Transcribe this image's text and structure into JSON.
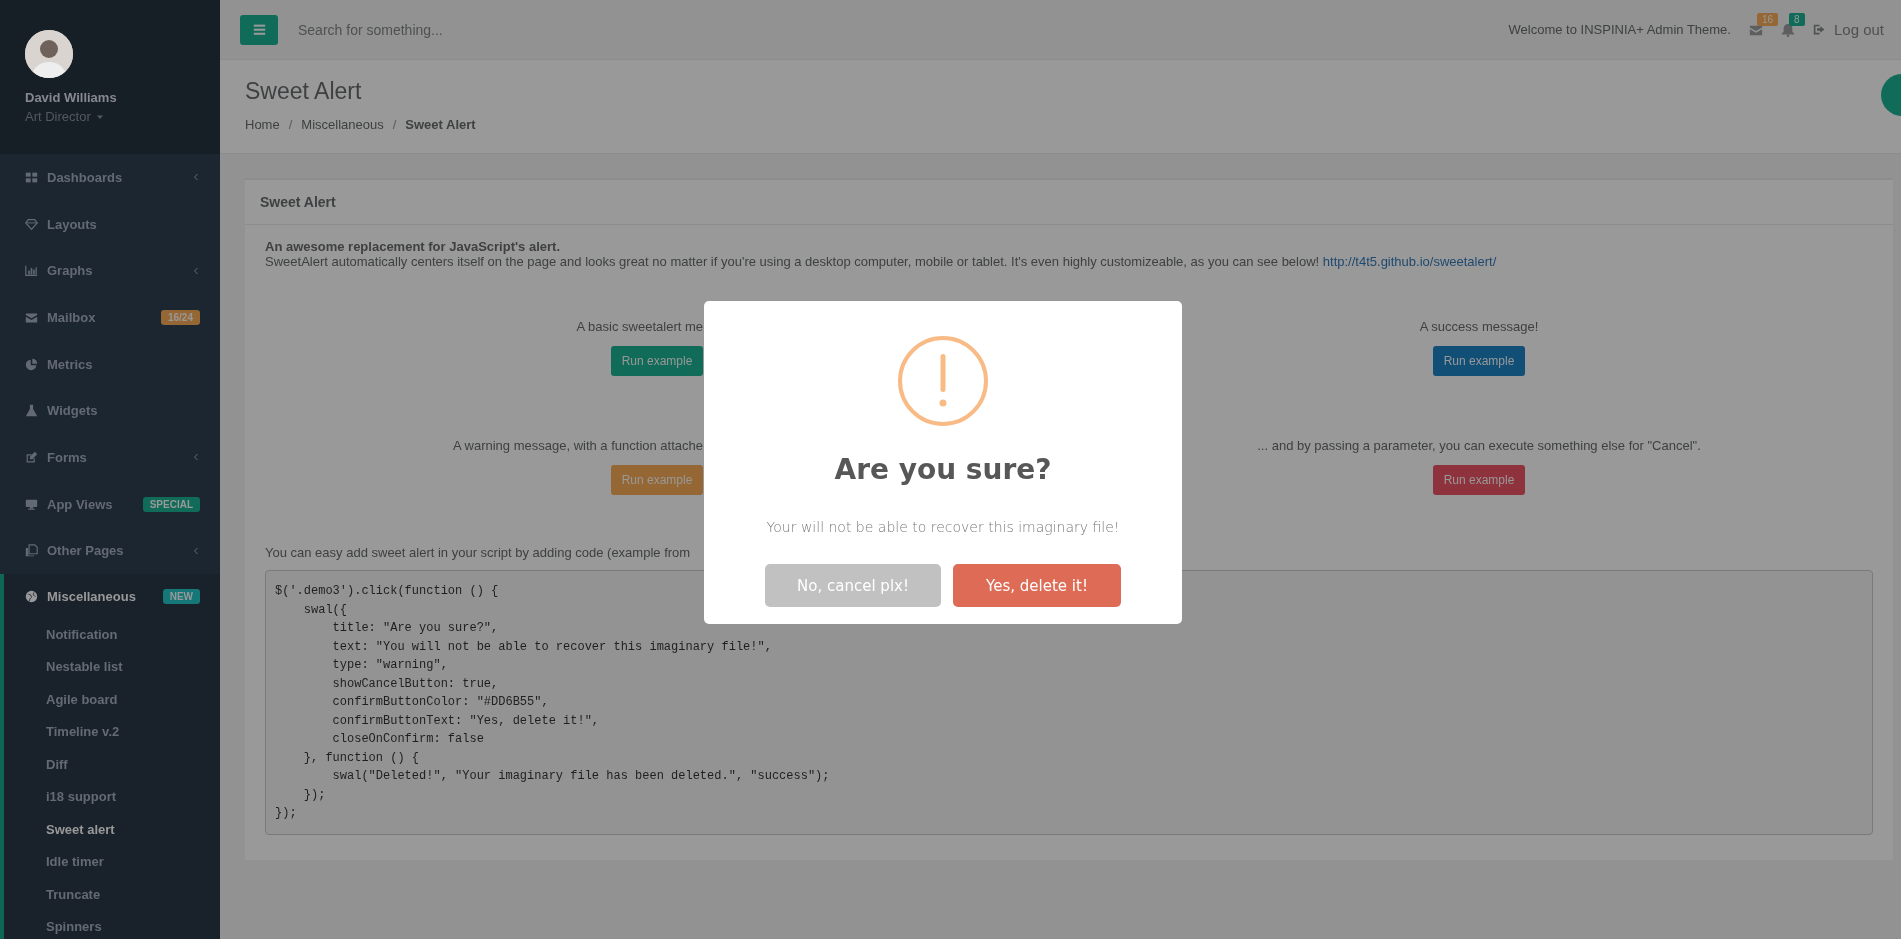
{
  "sidebar": {
    "profile": {
      "name": "David Williams",
      "role": "Art Director"
    },
    "items": [
      {
        "label": "Dashboards",
        "expandable": true,
        "selected": false
      },
      {
        "label": "Layouts",
        "expandable": false,
        "selected": false
      },
      {
        "label": "Graphs",
        "expandable": true,
        "selected": false
      },
      {
        "label": "Mailbox",
        "expandable": false,
        "selected": false,
        "badge": {
          "text": "16/24",
          "color": "#956735"
        }
      },
      {
        "label": "Metrics",
        "expandable": false,
        "selected": false
      },
      {
        "label": "Widgets",
        "expandable": false,
        "selected": false
      },
      {
        "label": "Forms",
        "expandable": true,
        "selected": false
      },
      {
        "label": "App Views",
        "expandable": false,
        "selected": false,
        "badge": {
          "text": "SPECIAL",
          "color": "#106b59"
        }
      },
      {
        "label": "Other Pages",
        "expandable": true,
        "selected": false
      },
      {
        "label": "Miscellaneous",
        "expandable": false,
        "selected": true,
        "badge": {
          "text": "NEW",
          "color": "#157778"
        },
        "children": [
          {
            "label": "Notification",
            "selected": false
          },
          {
            "label": "Nestable list",
            "selected": false
          },
          {
            "label": "Agile board",
            "selected": false
          },
          {
            "label": "Timeline v.2",
            "selected": false
          },
          {
            "label": "Diff",
            "selected": false
          },
          {
            "label": "i18 support",
            "selected": false
          },
          {
            "label": "Sweet alert",
            "selected": true
          },
          {
            "label": "Idle timer",
            "selected": false
          },
          {
            "label": "Truncate",
            "selected": false
          },
          {
            "label": "Spinners",
            "selected": false
          }
        ]
      }
    ]
  },
  "topbar": {
    "search": {
      "placeholder": "Search for something..."
    },
    "welcome": "Welcome to INSPINIA+ Admin Theme.",
    "notifications": [
      {
        "count": "16",
        "color": "#956735"
      },
      {
        "count": "8",
        "color": "#106b59"
      }
    ],
    "logout": "Log out"
  },
  "page_heading": {
    "title": "Sweet Alert",
    "separator": "/",
    "breadcrumb": [
      {
        "label": "Home",
        "selected": false
      },
      {
        "label": "Miscellaneous",
        "selected": false
      },
      {
        "label": "Sweet Alert",
        "selected": true
      }
    ]
  },
  "card": {
    "title": "Sweet Alert",
    "intro_heading": "An awesome replacement for JavaScript's alert.",
    "intro": "SweetAlert automatically centers itself on the page and looks great no matter if you're using a desktop computer, mobile or tablet. It's even highly customizeable, as you can see below!",
    "link": "http://t4t5.github.io/sweetalert/",
    "examples": [
      {
        "text": "A basic sweetalert me",
        "button": "Run example",
        "color": "#106b59"
      },
      {
        "text": "A success message!",
        "button": "Run example",
        "color": "#114f77"
      },
      {
        "text": "A warning message, with a function attache",
        "button": "Run example",
        "color": "#956735"
      },
      {
        "text": "... and by passing a parameter, you can execute something else for \"Cancel\".",
        "button": "Run example",
        "color": "#8e333d"
      }
    ],
    "code_intro": "You can easy add sweet alert in your script by adding code (example from",
    "code": "$('.demo3').click(function () {\n    swal({\n        title: \"Are you sure?\",\n        text: \"You will not be able to recover this imaginary file!\",\n        type: \"warning\",\n        showCancelButton: true,\n        confirmButtonColor: \"#DD6B55\",\n        confirmButtonText: \"Yes, delete it!\",\n        closeOnConfirm: false\n    }, function () {\n        swal(\"Deleted!\", \"Your imaginary file has been deleted.\", \"success\");\n    });\n});"
  },
  "modal": {
    "kind": "warning",
    "title": "Are you sure?",
    "text": "Your will not be able to recover this imaginary file!",
    "buttons": [
      {
        "label": "No, cancel plx!",
        "kind": "cancel"
      },
      {
        "label": "Yes, delete it!",
        "kind": "confirm",
        "color": "#dd6b55"
      }
    ]
  }
}
